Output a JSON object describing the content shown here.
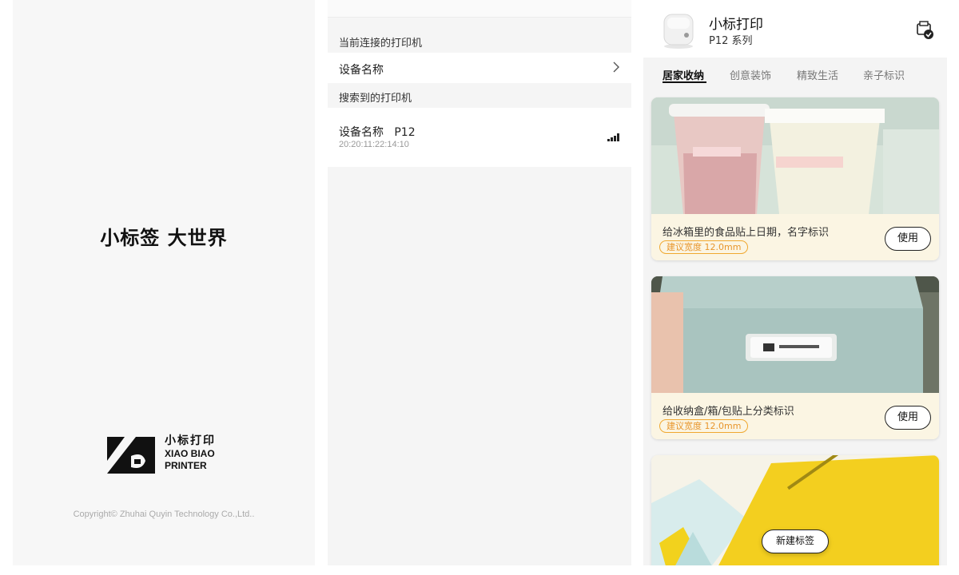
{
  "splash": {
    "slogan": "小标签  大世界",
    "brand_cn": "小标打印",
    "brand_en_line1": "XIAO BIAO",
    "brand_en_line2": "PRINTER",
    "copyright": "Copyright© Zhuhai Quyin Technology Co.,Ltd.."
  },
  "devices": {
    "current_header": "当前连接的打印机",
    "current_device": "设备名称",
    "found_header": "搜索到的打印机",
    "found_device": {
      "name": "设备名称   P12",
      "mac": "20:20:11:22:14:10"
    }
  },
  "home": {
    "printer_name": "小标打印",
    "printer_series": "P12 系列",
    "tabs": [
      {
        "label": "居家收纳",
        "active": true
      },
      {
        "label": "创意装饰",
        "active": false
      },
      {
        "label": "精致生活",
        "active": false
      },
      {
        "label": "亲子标识",
        "active": false
      }
    ],
    "cards": [
      {
        "desc": "给冰箱里的食品贴上日期，名字标识",
        "width_badge": "建议宽度 12.0mm",
        "use_label": "使用"
      },
      {
        "desc": "给收纳盒/箱/包贴上分类标识",
        "width_badge": "建议宽度 12.0mm",
        "use_label": "使用"
      }
    ],
    "new_label": "新建标签"
  },
  "colors": {
    "accent_orange": "#f0a830",
    "card_bg": "#fbf5e3",
    "text_dark": "#111111"
  }
}
